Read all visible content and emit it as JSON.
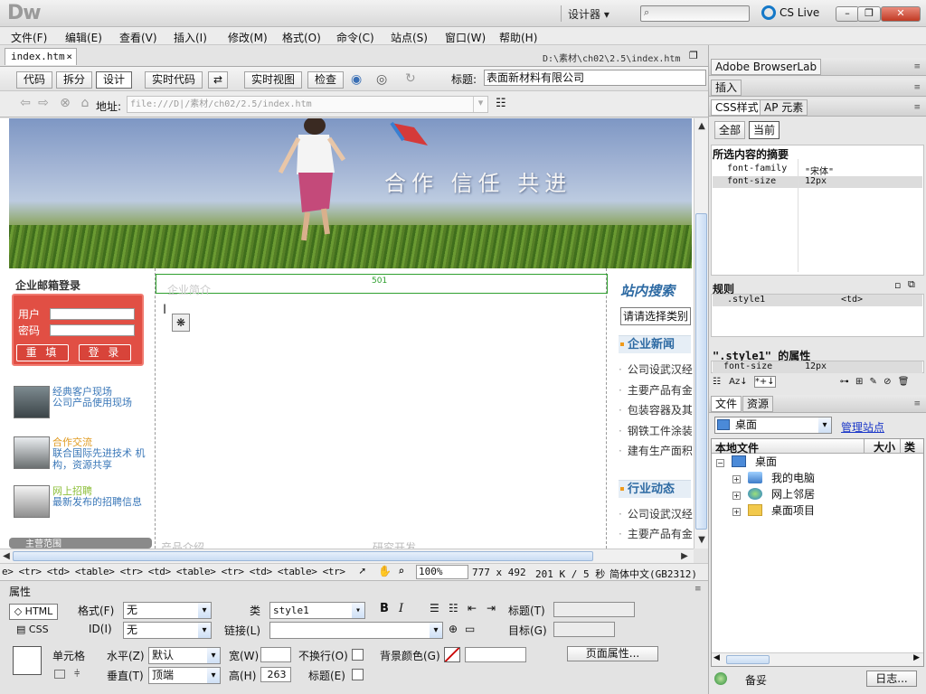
{
  "app": {
    "logo": "Dw",
    "workspace": "设计器",
    "cs_live": "CS Live",
    "minimize": "–",
    "restore": "❐",
    "close": "✕"
  },
  "menu": [
    "文件(F)",
    "编辑(E)",
    "查看(V)",
    "插入(I)",
    "修改(M)",
    "格式(O)",
    "命令(C)",
    "站点(S)",
    "窗口(W)",
    "帮助(H)"
  ],
  "document": {
    "tab": "index.htm",
    "tab_close": "×",
    "path": "D:\\素材\\ch02\\2.5\\index.htm",
    "view_buttons": [
      "代码",
      "拆分",
      "设计"
    ],
    "live_code": "实时代码",
    "live_view": "实时视图",
    "inspect": "检查",
    "title_label": "标题:",
    "title_value": "表面新材料有限公司",
    "address_label": "地址:",
    "address_value": "file:///D|/素材/ch02/2.5/index.htm"
  },
  "page": {
    "slogan": "合作   信任   共进",
    "mail_title": "企业邮箱登录",
    "user_label": "用户",
    "pass_label": "密码",
    "reset_btn": "重 填",
    "login_btn": "登 录",
    "promos": [
      {
        "t1": "经典客户现场",
        "t2": "公司产品使用现场"
      },
      {
        "t1": "合作交流",
        "t2": "联合国际先进技术 机构，资源共享"
      },
      {
        "t1": "网上招聘",
        "t2": "最新发布的招聘信息"
      }
    ],
    "left_bottom": "主营范围",
    "ruler_value": "501",
    "ruler_text": "企业简介",
    "mid_bottom_1": "产品介绍",
    "mid_bottom_2": "研究开发",
    "site_search": "站内搜索",
    "search_select": "请请选择类别",
    "news_title": "企业新闻",
    "news": [
      "公司设武汉经",
      "主要产品有金",
      "包装容器及其",
      "钢铁工件涂装",
      "建有生产面积"
    ],
    "industry_title": "行业动态",
    "industry": [
      "公司设武汉经",
      "主要产品有金"
    ]
  },
  "status": {
    "tagpath": "e> <tr> <td> <table> <tr> <td> <table> <tr> <td> <table> <tr> <td.... >",
    "zoom": "100%",
    "dims": "777 x 492",
    "size": "201 K / 5 秒",
    "encoding": "简体中文(GB2312)"
  },
  "properties": {
    "title": "属性",
    "html": "HTML",
    "css": "CSS",
    "format_label": "格式(F)",
    "format_value": "无",
    "id_label": "ID(I)",
    "id_value": "无",
    "class_label": "类",
    "class_value": "style1",
    "link_label": "链接(L)",
    "heading_label": "标题(T)",
    "target_label": "目标(G)",
    "cell_label": "单元格",
    "horz_label": "水平(Z)",
    "horz_value": "默认",
    "vert_label": "垂直(T)",
    "vert_value": "顶端",
    "width_label": "宽(W)",
    "width_value": "",
    "height_label": "高(H)",
    "height_value": "263",
    "nowrap_label": "不换行(O)",
    "header_label": "标题(E)",
    "bgcolor_label": "背景颜色(G)",
    "page_props": "页面属性..."
  },
  "panels": {
    "browserlab": "Adobe BrowserLab",
    "insert": "插入",
    "css_tab": "CSS样式",
    "ap_tab": "AP 元素",
    "all": "全部",
    "current": "当前",
    "summary_title": "所选内容的摘要",
    "summary": [
      {
        "k": "font-family",
        "v": "\"宋体\""
      },
      {
        "k": "font-size",
        "v": "12px"
      }
    ],
    "rules_title": "规则",
    "rule": {
      "k": ".style1",
      "v": "<td>"
    },
    "props_title": "\".style1\" 的属性",
    "prop": {
      "k": "font-size",
      "v": "12px"
    },
    "files_tab": "文件",
    "assets_tab": "资源",
    "location": "桌面",
    "manage": "管理站点",
    "col_local": "本地文件",
    "col_size": "大小",
    "col_type": "类型",
    "tree": [
      "桌面",
      "我的电脑",
      "网上邻居",
      "桌面项目"
    ],
    "bottom_label": "备妥",
    "log_btn": "日志..."
  },
  "colors": {
    "accent": "#1478c8",
    "login_box": "#e14f44",
    "link_blue": "#2d6aa3"
  }
}
